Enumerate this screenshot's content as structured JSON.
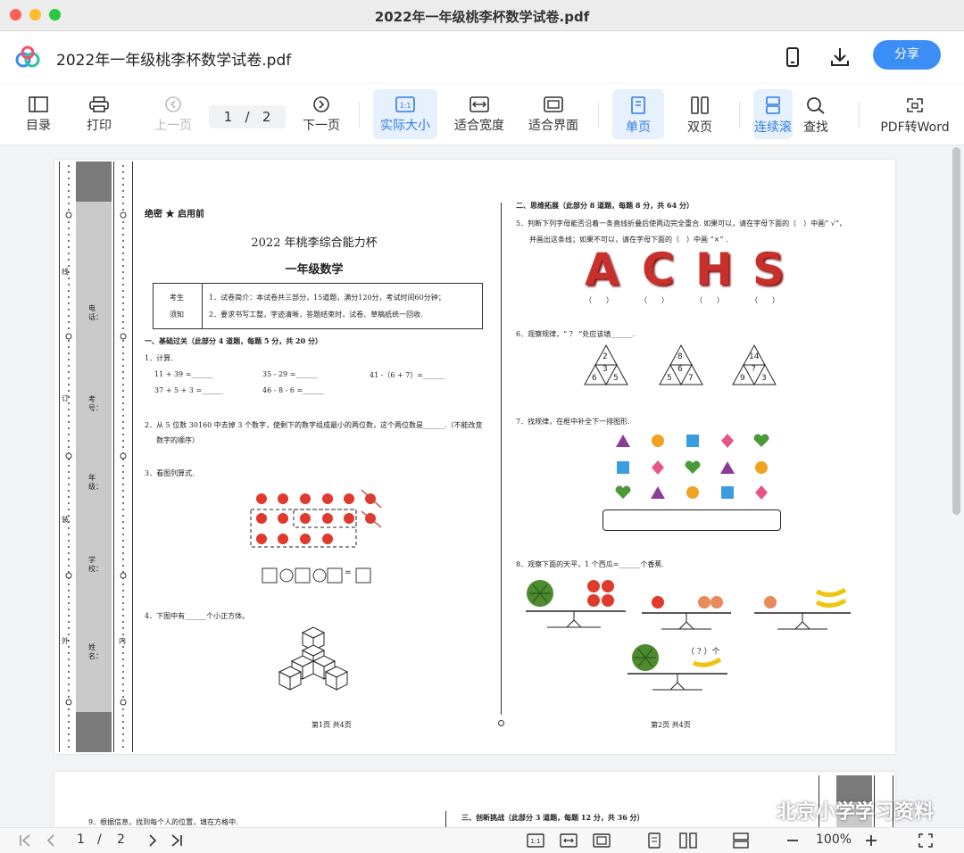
{
  "window": {
    "title": "2022年一年级桃李杯数学试卷.pdf"
  },
  "header": {
    "file_name": "2022年一年级桃李杯数学试卷.pdf",
    "share_label": "分享"
  },
  "toolbar": {
    "toc": "目录",
    "print": "打印",
    "prev": "上一页",
    "page_current": "1",
    "page_sep": "/",
    "page_total": "2",
    "next": "下一页",
    "actual_size": "实际大小",
    "fit_width": "适合宽度",
    "fit_page": "适合界面",
    "single": "单页",
    "double": "双页",
    "continuous": "连续滚",
    "find": "查找",
    "pdf_word": "PDF转Word"
  },
  "colors": {
    "accent": "#3b8ef5",
    "active_bg": "#e7f0fd"
  },
  "exam": {
    "secret": "绝密 ★ 启用前",
    "title": "2022 年桃李综合能力杯",
    "subtitle": "一年级数学",
    "notice_label1": "考生",
    "notice_label2": "须知",
    "notice1": "1．试卷简介：本试卷共三部分，15道题，满分120分，考试时间60分钟；",
    "notice2": "2．要求书写工整，字迹清晰，答题结束时，试卷、草稿纸统一回收.",
    "section1": "一、基础过关（此部分 4 道题，每题 5 分，共 20 分）",
    "q1": "1．计算.",
    "q1_a": "11 + 39 =______",
    "q1_b": "35 - 29 =______",
    "q1_c": "41 -（6 + 7）=______",
    "q1_d": "37 + 5 + 3 =______",
    "q1_e": "46 - 8 - 6 =______",
    "q2": "2．从 5 位数 30160 中去掉 3 个数字，使剩下的数字组成最小的两位数，这个两位数是______.（不能改变",
    "q2b": "数字的顺序）",
    "q3": "3．看图列算式.",
    "q3_eq": "=",
    "q4": "4．下图中有______个小正方体。",
    "page1_footer": "第1页 共4页",
    "section2": "二、思维拓展（此部分 8 道题，每题 8 分，共 64 分）",
    "q5": "5．判断下列字母能否沿着一条直线折叠后使两边完全重合. 如果可以，请在字母下面的（　）中画“ √”，",
    "q5b": "并画出这条线；如果不可以，请在字母下面的（　）中画 “×” .",
    "letters": [
      "A",
      "C",
      "H",
      "S"
    ],
    "paren": "（　　）",
    "q6": "6．观察规律，“ ？ ”处应该填______.",
    "tri1": [
      "2",
      "3",
      "6",
      "5"
    ],
    "tri2": [
      "8",
      "6",
      "5",
      "7"
    ],
    "tri3": [
      "14",
      "?",
      "9",
      "3"
    ],
    "q7": "7．找规律，在框中补全下一排图形.",
    "q8": "8．观察下面的天平，1 个西瓜=______个香蕉.",
    "q8_unknown": "（ ? ）个",
    "page2_footer": "第2页 共4页",
    "binding_labels": [
      "电话：",
      "考号：",
      "年级：",
      "学校：",
      "姓名："
    ],
    "binding_words": [
      "线",
      "订",
      "装",
      "外",
      "内"
    ],
    "q9": "9．根据信息，找到每个人的位置，填在方格中.",
    "section3": "三、创新挑战（此部分 3 道题，每题 12 分，共 36 分）"
  },
  "watermark": "北京小学学习资料",
  "statusbar": {
    "page_current": "1",
    "page_sep": "/",
    "page_total": "2",
    "zoom": "100%"
  }
}
